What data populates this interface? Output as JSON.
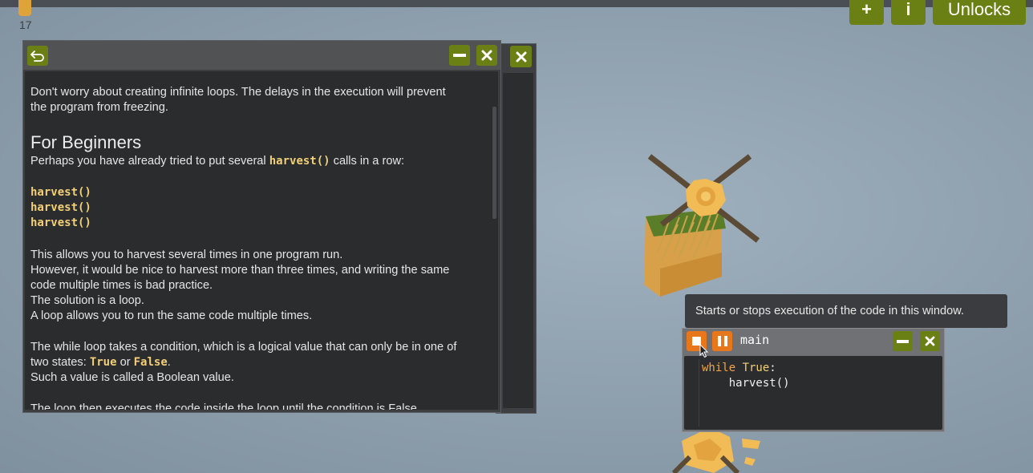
{
  "hud": {
    "hay_count": "17",
    "buttons": {
      "add": "+",
      "info": "i",
      "unlocks": "Unlocks"
    }
  },
  "docs_window": {
    "paragraphs": {
      "p1_line1": "Don't worry about creating infinite loops. The delays in the execution will prevent",
      "p1_line2": "the program from freezing.",
      "heading": "For Beginners",
      "p2_pre": "Perhaps you have already tried to put several ",
      "p2_code": "harvest()",
      "p2_post": " calls in a row:",
      "code_line_1": "harvest()",
      "code_line_2": "harvest()",
      "code_line_3": "harvest()",
      "p3_line1": "This allows you to harvest several times in one program run.",
      "p3_line2": "However, it would be nice to harvest more than three times, and writing the same",
      "p3_line3": "code multiple times is bad practice.",
      "p3_line4": "The solution is a loop.",
      "p3_line5": "A loop allows you to run the same code multiple times.",
      "p4_line1": "The while loop takes a condition, which is a logical value that can only be in one of",
      "p4_line2_pre": "two states: ",
      "p4_true": "True",
      "p4_or": " or ",
      "p4_false": "False",
      "p4_line2_post": ".",
      "p4_line3": "Such a value is called a Boolean value.",
      "p5_line1": "The loop then executes the code inside the loop until the condition is False."
    }
  },
  "tooltip": {
    "text": "Starts or stops execution of the code in this window."
  },
  "code_window": {
    "title": "main",
    "lines": {
      "l1_kw": "while ",
      "l1_val": "True",
      "l1_colon": ":",
      "l2": "    harvest()"
    }
  },
  "colors": {
    "button_green": "#6a7f14",
    "button_orange": "#e8771c",
    "code_yellow": "#f2cf78"
  },
  "icons": [
    "undo-arrow-icon",
    "minimize-icon",
    "close-icon",
    "stop-icon",
    "pause-icon",
    "hay-icon",
    "mouse-cursor-icon"
  ]
}
